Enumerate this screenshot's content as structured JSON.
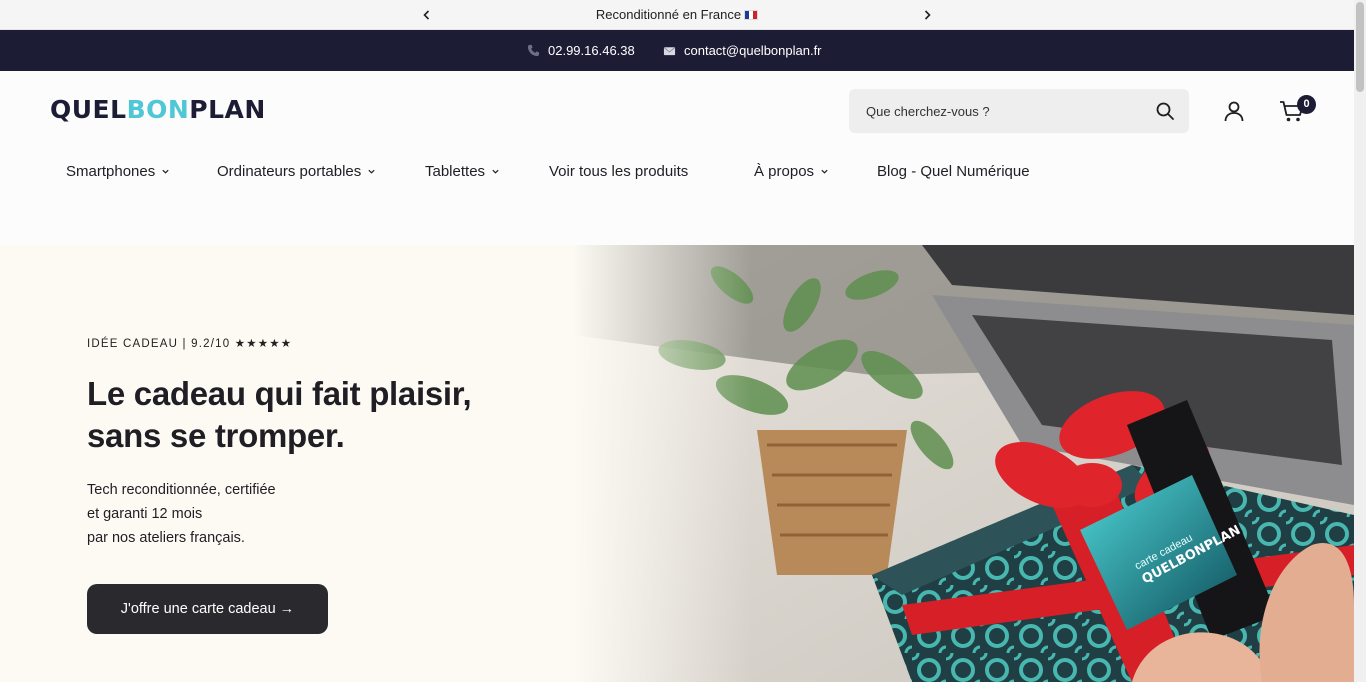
{
  "announcement": {
    "message": "Reconditionné en France",
    "prev_icon": "chevron-left-icon",
    "next_icon": "chevron-right-icon"
  },
  "contact": {
    "phone": "02.99.16.46.38",
    "email": "contact@quelbonplan.fr"
  },
  "header": {
    "logo": {
      "part1": "QUEL",
      "part2": "BON",
      "part3": "PLAN"
    },
    "search_placeholder": "Que cherchez-vous ?",
    "cart_count": "0"
  },
  "nav": {
    "items": [
      {
        "label": "Smartphones",
        "has_dropdown": true
      },
      {
        "label": "Ordinateurs portables",
        "has_dropdown": true
      },
      {
        "label": "Tablettes",
        "has_dropdown": true
      },
      {
        "label": "Voir tous les produits",
        "has_dropdown": false
      },
      {
        "label": "À propos",
        "has_dropdown": true
      },
      {
        "label": "Blog - Quel Numérique",
        "has_dropdown": false
      }
    ]
  },
  "hero": {
    "eyebrow": "IDÉE CADEAU | 9.2/10 ★★★★★",
    "headline_line1": "Le cadeau qui fait plaisir,",
    "headline_line2": "sans se tromper.",
    "sub_line1": "Tech reconditionnée, certifiée",
    "sub_line2": "et garanti 12 mois",
    "sub_line3": "par nos ateliers français.",
    "cta": "J'offre une carte cadeau →",
    "card_text1": "carte cadeau",
    "card_text2": "QUELBONPLAN"
  },
  "colors": {
    "navy": "#1d1c35",
    "teal": "#4fc7d6",
    "cta_bg": "#2a2a2e",
    "hero_bg": "#fdfaf4"
  }
}
